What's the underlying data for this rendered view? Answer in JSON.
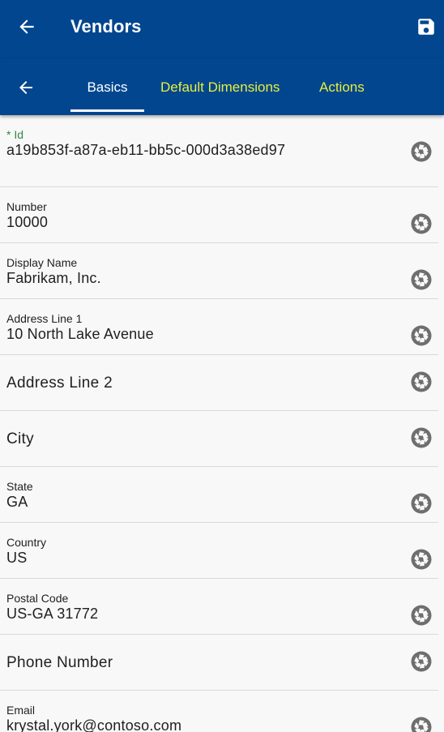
{
  "appbar": {
    "title": "Vendors"
  },
  "tabs": {
    "basics": "Basics",
    "default_dimensions": "Default Dimensions",
    "actions": "Actions"
  },
  "fields": {
    "id": {
      "label": "* Id",
      "value": "a19b853f-a87a-eb11-bb5c-000d3a38ed97"
    },
    "number": {
      "label": "Number",
      "value": "10000"
    },
    "display_name": {
      "label": "Display Name",
      "value": "Fabrikam, Inc."
    },
    "address_line_1": {
      "label": "Address Line 1",
      "value": "10 North Lake Avenue"
    },
    "address_line_2": {
      "label": "Address Line 2"
    },
    "city": {
      "label": "City"
    },
    "state": {
      "label": "State",
      "value": "GA"
    },
    "country": {
      "label": "Country",
      "value": "US"
    },
    "postal_code": {
      "label": "Postal Code",
      "value": "US-GA 31772"
    },
    "phone_number": {
      "label": "Phone Number"
    },
    "email": {
      "label": "Email",
      "value": "krystal.york@contoso.com"
    }
  },
  "colors": {
    "header": "#01468f",
    "tab_accent": "#e8ef3a",
    "required_label": "#2e8b3c"
  }
}
